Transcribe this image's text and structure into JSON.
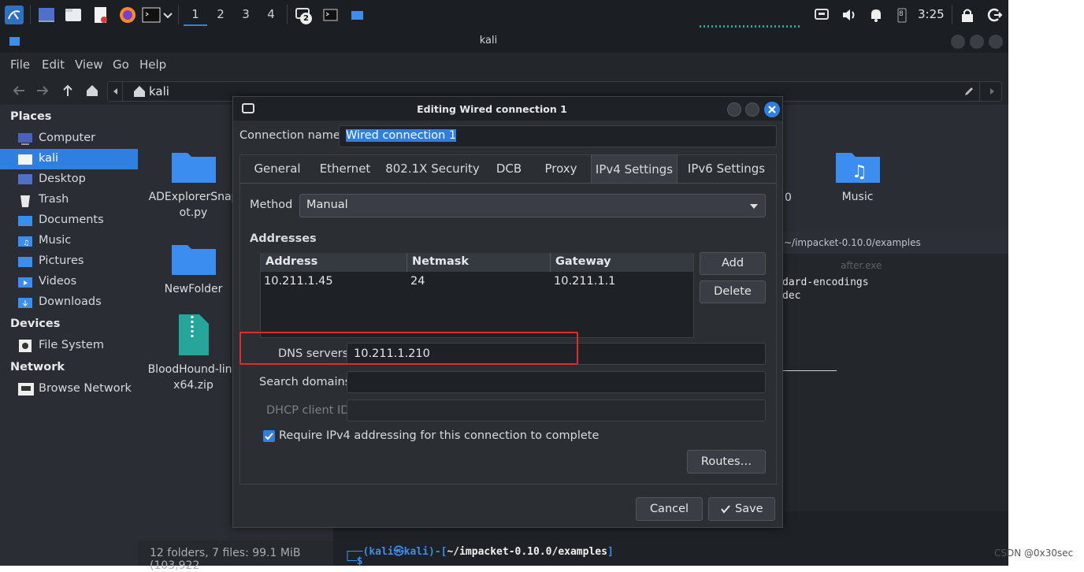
{
  "taskbar": {
    "workspaces": [
      "1",
      "2",
      "3",
      "4"
    ],
    "active_workspace": "1",
    "badge": "2",
    "battery": "8",
    "clock": "3:25"
  },
  "window": {
    "title": "kali",
    "menu": [
      "File",
      "Edit",
      "View",
      "Go",
      "Help"
    ],
    "location": "kali"
  },
  "sidebar": {
    "places_heading": "Places",
    "places": [
      {
        "label": "Computer",
        "icon": "computer-icon"
      },
      {
        "label": "kali",
        "icon": "home-folder-icon",
        "selected": true
      },
      {
        "label": "Desktop",
        "icon": "desktop-icon"
      },
      {
        "label": "Trash",
        "icon": "trash-icon"
      },
      {
        "label": "Documents",
        "icon": "documents-icon"
      },
      {
        "label": "Music",
        "icon": "music-folder-icon"
      },
      {
        "label": "Pictures",
        "icon": "pictures-icon"
      },
      {
        "label": "Videos",
        "icon": "videos-icon"
      },
      {
        "label": "Downloads",
        "icon": "downloads-icon"
      }
    ],
    "devices_heading": "Devices",
    "devices": [
      {
        "label": "File System",
        "icon": "drive-icon"
      }
    ],
    "network_heading": "Network",
    "network": [
      {
        "label": "Browse Network",
        "icon": "network-icon"
      }
    ]
  },
  "files": [
    {
      "line1": "ADExplorerSnap",
      "line2": "ot.py",
      "icon": "folder-icon"
    },
    {
      "line1": "NewFolder",
      "line2": "",
      "icon": "folder-icon"
    },
    {
      "line1": "BloodHound-linu",
      "line2": "x64.zip",
      "icon": "zip-file-icon"
    },
    {
      "line1": "Music",
      "line2": "",
      "icon": "music-folder-icon"
    },
    {
      "line1": "after.exe",
      "line2": "",
      "icon": "exe-file-icon"
    }
  ],
  "partial_label": "0",
  "status_text": "12 folders, 7 files: 99.1 MiB (103,922",
  "terminal": {
    "title": "~/impacket-0.10.0/examples",
    "line1": "dard-encodings",
    "line2": "dec",
    "prompt_user": "kali",
    "prompt_at": "㉿",
    "prompt_host": "kali",
    "prompt_path": "~/impacket-0.10.0/examples",
    "prompt_symbol": "$"
  },
  "dialog": {
    "title": "Editing Wired connection 1",
    "connection_name_label": "Connection name",
    "connection_name": "Wired connection 1",
    "tabs": [
      "General",
      "Ethernet",
      "802.1X Security",
      "DCB",
      "Proxy",
      "IPv4 Settings",
      "IPv6 Settings"
    ],
    "active_tab": "IPv4 Settings",
    "method_label": "Method",
    "method_value": "Manual",
    "addresses_label": "Addresses",
    "columns": [
      "Address",
      "Netmask",
      "Gateway"
    ],
    "rows": [
      [
        "10.211.1.45",
        "24",
        "10.211.1.1"
      ]
    ],
    "add_label": "Add",
    "delete_label": "Delete",
    "dns_label": "DNS servers",
    "dns_value": "10.211.1.210",
    "search_domains_label": "Search domains",
    "search_domains_value": "",
    "dhcp_label": "DHCP client ID",
    "dhcp_value": "",
    "require_label": "Require IPv4 addressing for this connection to complete",
    "require_checked": true,
    "routes_label": "Routes…",
    "cancel_label": "Cancel",
    "save_label": "Save"
  },
  "watermark": "CSDN @0x30sec",
  "colors": {
    "accent": "#2f7ee2",
    "highlight_box": "#e02b2b",
    "folder": "#3b8ef0"
  }
}
